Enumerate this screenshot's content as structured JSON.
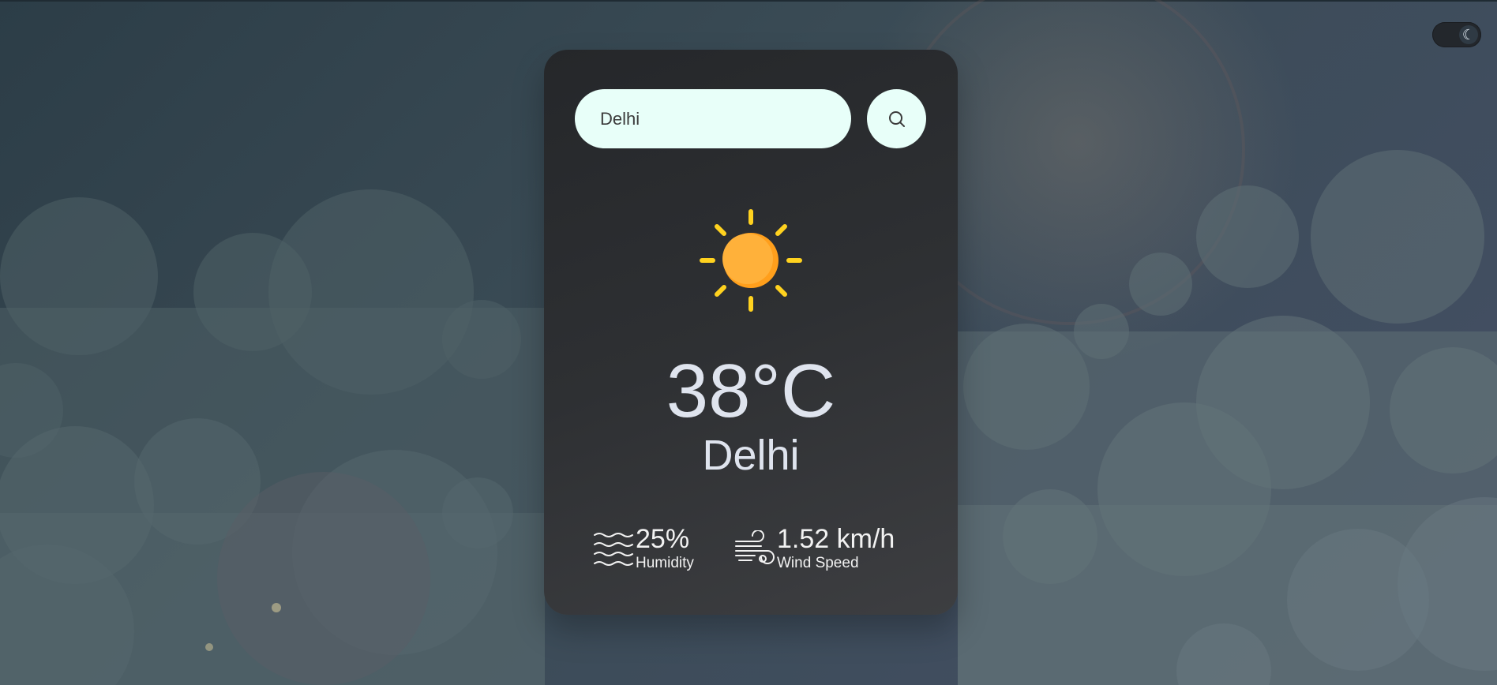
{
  "theme_toggle": {
    "icon": "moon-icon",
    "glyph": "☾"
  },
  "search": {
    "value": "Delhi",
    "placeholder": "",
    "button_icon": "search-icon"
  },
  "weather": {
    "icon": "sun-icon",
    "temperature": "38°C",
    "city": "Delhi"
  },
  "details": {
    "humidity": {
      "value": "25%",
      "label": "Humidity",
      "icon": "humidity-waves-icon"
    },
    "wind": {
      "value": "1.52 km/h",
      "label": "Wind Speed",
      "icon": "wind-icon"
    }
  },
  "colors": {
    "card_bg": "#2e3033",
    "input_bg": "#e8fff9",
    "sun": "#ffb13a",
    "rays": "#ffd21f",
    "text": "#dfe4ee"
  }
}
